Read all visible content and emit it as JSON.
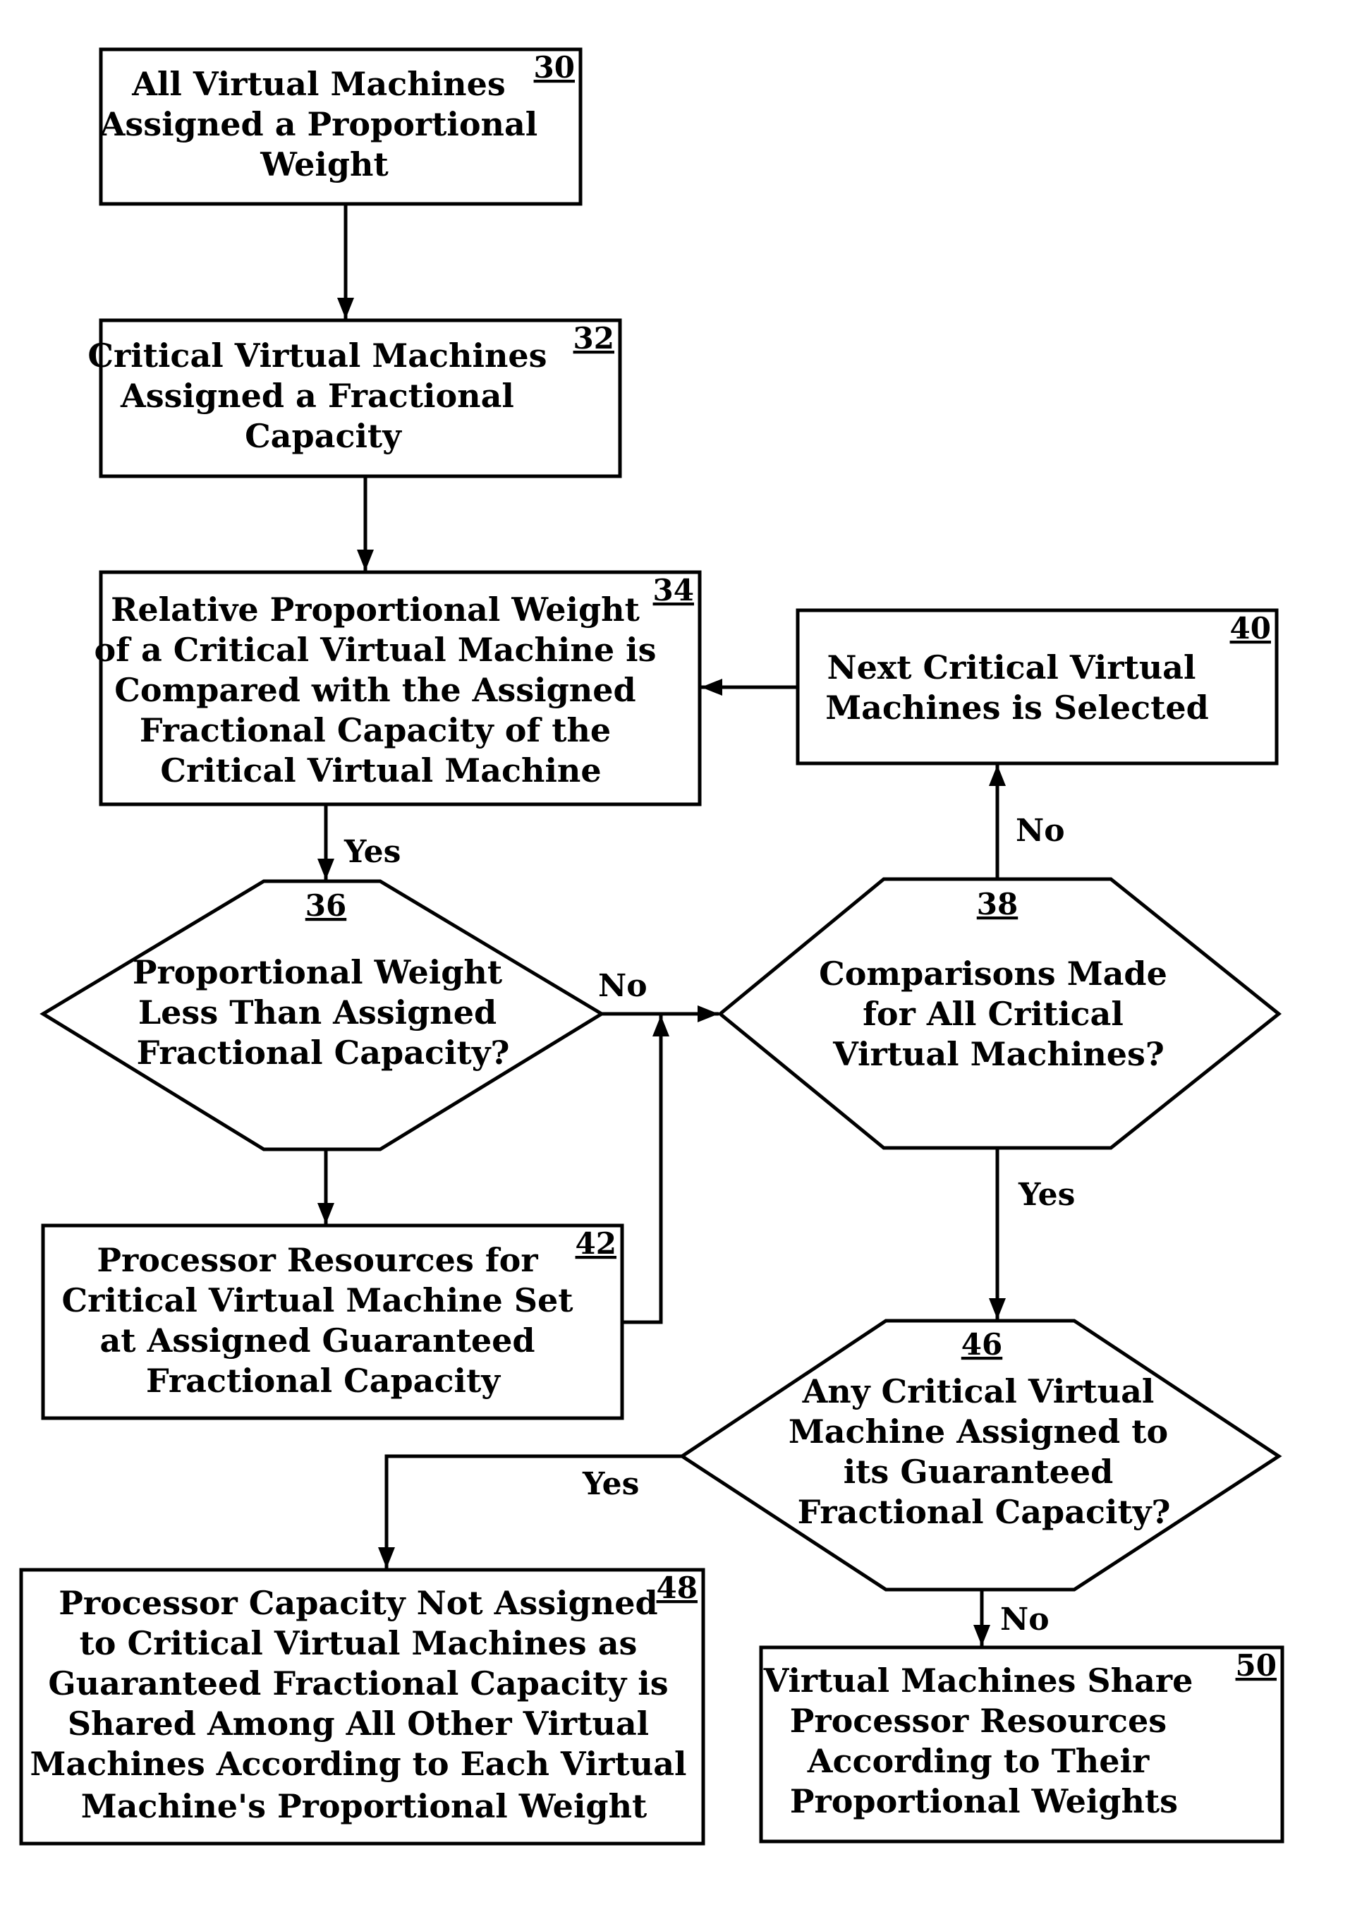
{
  "figure": {
    "type": "flowchart",
    "nodes": {
      "n30": {
        "ref": "30",
        "kind": "process",
        "lines": [
          "All Virtual Machines",
          "Assigned a Proportional",
          "Weight"
        ]
      },
      "n32": {
        "ref": "32",
        "kind": "process",
        "lines": [
          "Critical Virtual Machines",
          "Assigned a Fractional",
          "Capacity"
        ]
      },
      "n34": {
        "ref": "34",
        "kind": "process",
        "lines": [
          "Relative Proportional Weight",
          "of a Critical Virtual Machine is",
          "Compared with the Assigned",
          "Fractional Capacity of the",
          "Critical Virtual Machine"
        ]
      },
      "n36": {
        "ref": "36",
        "kind": "decision",
        "lines": [
          "Proportional Weight",
          "Less Than Assigned",
          "Fractional Capacity?"
        ]
      },
      "n38": {
        "ref": "38",
        "kind": "decision",
        "lines": [
          "Comparisons Made",
          "for All Critical",
          "Virtual Machines?"
        ]
      },
      "n40": {
        "ref": "40",
        "kind": "process",
        "lines": [
          "Next Critical Virtual",
          "Machines is Selected"
        ]
      },
      "n42": {
        "ref": "42",
        "kind": "process",
        "lines": [
          "Processor Resources for",
          "Critical Virtual Machine Set",
          "at Assigned Guaranteed",
          "Fractional Capacity"
        ]
      },
      "n46": {
        "ref": "46",
        "kind": "decision",
        "lines": [
          "Any Critical Virtual",
          "Machine Assigned to",
          "its Guaranteed",
          "Fractional Capacity?"
        ]
      },
      "n48": {
        "ref": "48",
        "kind": "process",
        "lines": [
          "Processor Capacity Not Assigned",
          "to Critical Virtual Machines as",
          "Guaranteed Fractional Capacity is",
          "Shared Among All Other Virtual",
          "Machines According to Each Virtual",
          "Machine's Proportional Weight"
        ]
      },
      "n50": {
        "ref": "50",
        "kind": "process",
        "lines": [
          "Virtual Machines Share",
          "Processor Resources",
          "According to Their",
          "Proportional Weights"
        ]
      }
    },
    "edges": [
      {
        "from": "30",
        "to": "32",
        "label": ""
      },
      {
        "from": "32",
        "to": "34",
        "label": ""
      },
      {
        "from": "34",
        "to": "36",
        "label": "Yes"
      },
      {
        "from": "36",
        "to": "38",
        "label": "No"
      },
      {
        "from": "36",
        "to": "42",
        "label": ""
      },
      {
        "from": "42",
        "to": "38",
        "label": ""
      },
      {
        "from": "38",
        "to": "40",
        "label": "No"
      },
      {
        "from": "40",
        "to": "34",
        "label": ""
      },
      {
        "from": "38",
        "to": "46",
        "label": "Yes"
      },
      {
        "from": "46",
        "to": "48",
        "label": "Yes"
      },
      {
        "from": "46",
        "to": "50",
        "label": "No"
      }
    ],
    "edge_labels": {
      "yes_34_36": "Yes",
      "no_36_38": "No",
      "no_38_40": "No",
      "yes_38_46": "Yes",
      "yes_46_48": "Yes",
      "no_46_50": "No"
    }
  }
}
